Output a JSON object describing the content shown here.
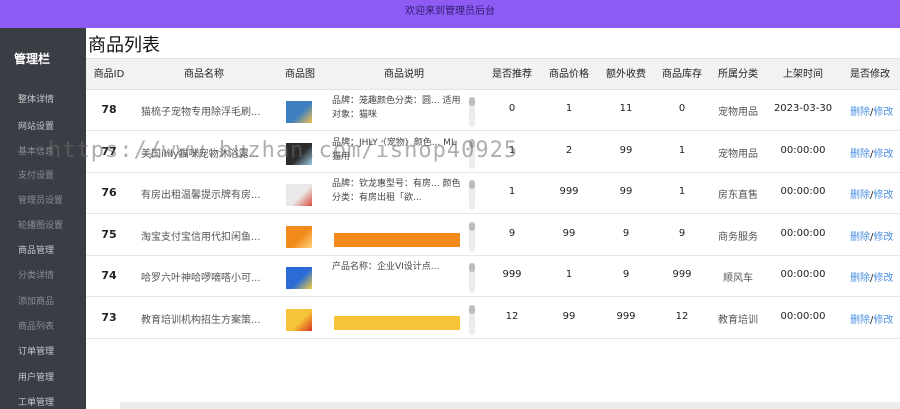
{
  "topbar": {
    "title": "欢迎来到管理员后台"
  },
  "sidebar": {
    "brand": "管理栏",
    "items": [
      {
        "label": "整体详情",
        "style": "mid"
      },
      {
        "label": "网站设置",
        "style": "mid"
      },
      {
        "label": "基本信息",
        "style": "dim"
      },
      {
        "label": "支付设置",
        "style": "dim"
      },
      {
        "label": "管理员设置",
        "style": "dim"
      },
      {
        "label": "轮播图设置",
        "style": "dim"
      },
      {
        "label": "商品管理",
        "style": "mid"
      },
      {
        "label": "分类详情",
        "style": "dim"
      },
      {
        "label": "添加商品",
        "style": "dim"
      },
      {
        "label": "商品列表",
        "style": "dim"
      },
      {
        "label": "订单管理",
        "style": "mid"
      },
      {
        "label": "用户管理",
        "style": "mid"
      },
      {
        "label": "工单管理",
        "style": "mid"
      }
    ]
  },
  "page": {
    "title": "商品列表"
  },
  "table": {
    "headers": [
      "商品ID",
      "商品名称",
      "商品图",
      "商品说明",
      "是否推荐",
      "商品价格",
      "额外收费",
      "商品库存",
      "所属分类",
      "上架时间",
      "是否修改"
    ],
    "rows": [
      {
        "id": "78",
        "name": "猫梳子宠物专用除浮毛刷...",
        "desc": "品牌：笼趣颜色分类：圆... 适用对象：猫咪",
        "recommend": "0",
        "price": "1",
        "extra": "11",
        "stock": "0",
        "category": "宠物用品",
        "date": "2023-03-30",
        "thumb_color": "#3d7fbf",
        "thumb_accent": "#f2c14e"
      },
      {
        "id": "77",
        "name": "美国ihly猫咪宠物沐浴露...",
        "desc": "品牌：JHLY（宠物）颜色... ML 猫用",
        "recommend": "1",
        "price": "2",
        "extra": "99",
        "stock": "1",
        "category": "宠物用品",
        "date": "00:00:00",
        "thumb_color": "#2c2c2c",
        "thumb_accent": "#9ad0ea"
      },
      {
        "id": "76",
        "name": "有房出租温馨提示牌有房...",
        "desc": "品牌：钦龙惠型号：有房... 颜色分类：有房出租「欲...",
        "recommend": "1",
        "price": "999",
        "extra": "99",
        "stock": "1",
        "category": "房东直售",
        "date": "00:00:00",
        "thumb_color": "#e9e9e9",
        "thumb_accent": "#d94a3d"
      },
      {
        "id": "75",
        "name": "淘宝支付宝信用代扣闲鱼...",
        "desc": "",
        "recommend": "9",
        "price": "99",
        "extra": "9",
        "stock": "9",
        "category": "商务服务",
        "date": "00:00:00",
        "thumb_color": "#f28b1c",
        "thumb_accent": "#ffd27a"
      },
      {
        "id": "74",
        "name": "哈罗六叶神哈啰嘀嗒小可...",
        "desc": "产品名称：企业VI设计点...",
        "recommend": "999",
        "price": "1",
        "extra": "9",
        "stock": "999",
        "category": "顺风车",
        "date": "00:00:00",
        "thumb_color": "#2a6bd6",
        "thumb_accent": "#f5d142"
      },
      {
        "id": "73",
        "name": "教育培训机构招生方案策...",
        "desc": "",
        "recommend": "12",
        "price": "99",
        "extra": "999",
        "stock": "12",
        "category": "教育培训",
        "date": "00:00:00",
        "thumb_color": "#f5c437",
        "thumb_accent": "#d8341f"
      }
    ],
    "ops": {
      "delete": "删除",
      "sep": "/",
      "edit": "修改"
    }
  },
  "watermark": "https://www.huzhan.com/ishop40925"
}
